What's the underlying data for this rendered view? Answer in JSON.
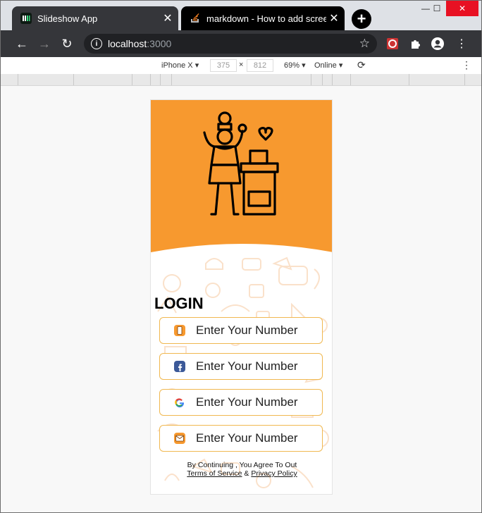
{
  "browser": {
    "tabs": [
      {
        "title": "Slideshow App",
        "favicon": "app-favicon-icon"
      },
      {
        "title": "markdown - How to add screens",
        "favicon": "stackoverflow-icon"
      }
    ],
    "new_tab_label": "+",
    "address": {
      "host": "localhost",
      "port": ":3000"
    }
  },
  "devtools": {
    "device": "iPhone X",
    "width": "375",
    "times": "×",
    "height": "812",
    "zoom": "69%",
    "network": "Online"
  },
  "app": {
    "login_title": "LOGIN",
    "buttons": [
      {
        "label": "Enter Your Number",
        "icon": "phone-icon"
      },
      {
        "label": "Enter Your Number",
        "icon": "facebook-icon"
      },
      {
        "label": "Enter Your Number",
        "icon": "google-icon"
      },
      {
        "label": "Enter Your Number",
        "icon": "mail-icon"
      }
    ],
    "terms": {
      "prefix": "By Continuing , You Agree To Out",
      "tos": "Terms of Service",
      "amp": "&",
      "privacy": "Privacy Policy"
    },
    "colors": {
      "accent": "#f7992f",
      "border": "#f0b850"
    }
  }
}
